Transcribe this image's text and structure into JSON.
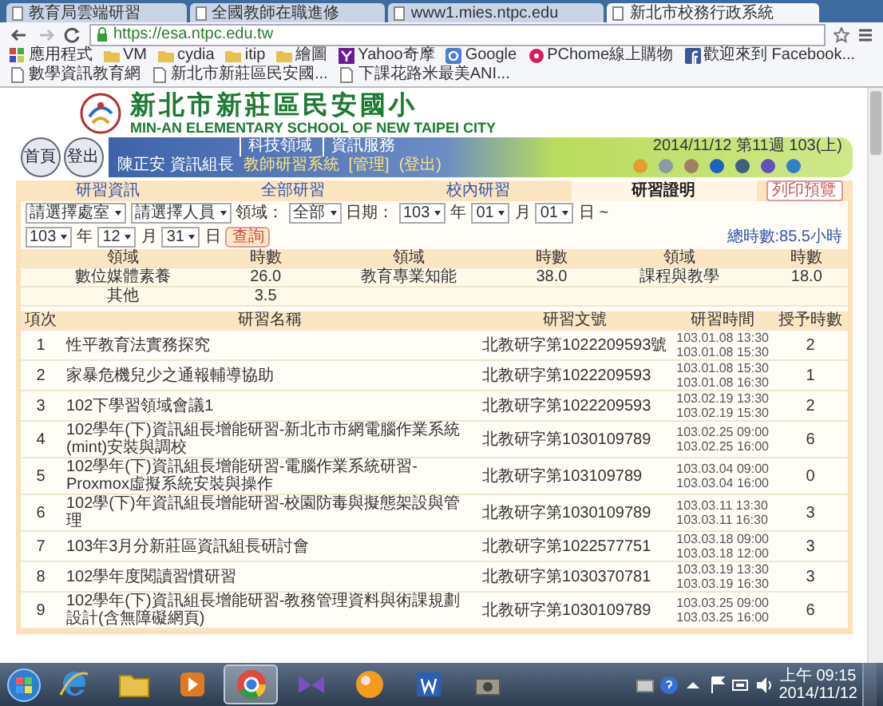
{
  "browser": {
    "tabs": [
      {
        "title": "教育局雲端研習",
        "selected": false
      },
      {
        "title": "全國教師在職進修",
        "selected": false
      },
      {
        "title": "www1.mies.ntpc.edu",
        "selected": false
      },
      {
        "title": "新北市校務行政系統",
        "selected": true
      }
    ],
    "address": "https://esa.ntpc.edu.tw",
    "bookmarks": [
      {
        "kind": "apps",
        "label": "應用程式"
      },
      {
        "kind": "folder",
        "label": "VM"
      },
      {
        "kind": "folder",
        "label": "cydia"
      },
      {
        "kind": "folder",
        "label": "itip"
      },
      {
        "kind": "folder",
        "label": "繪圖"
      },
      {
        "kind": "yahoo",
        "label": "Yahoo奇摩"
      },
      {
        "kind": "google",
        "label": "Google"
      },
      {
        "kind": "pchome",
        "label": "PChome線上購物"
      },
      {
        "kind": "facebook",
        "label": "歡迎來到 Facebook..."
      },
      {
        "kind": "page",
        "label": "數學資訊教育網"
      },
      {
        "kind": "page",
        "label": "新北市新莊區民安國..."
      },
      {
        "kind": "page",
        "label": "下課花路米最美ANI..."
      }
    ]
  },
  "school": {
    "name": "新北市新莊區民安國小",
    "english_name": "MIN-AN ELEMENTARY SCHOOL OF NEW TAIPEI CITY"
  },
  "nav": {
    "round_buttons": [
      "首頁",
      "登出"
    ],
    "links": [
      "科技領域",
      "資訊服務"
    ],
    "date": "2014/11/12 第11週 103(上)",
    "user": "陳正安 資訊組長",
    "system": "教師研習系統",
    "admin": "[管理]",
    "logout": "(登出)"
  },
  "page_tabs": [
    {
      "label": "研習資訊",
      "selected": false
    },
    {
      "label": "全部研習",
      "selected": false
    },
    {
      "label": "校內研習",
      "selected": false
    },
    {
      "label": "研習證明",
      "selected": true
    }
  ],
  "print_button": "列印預覽",
  "filter_rows": [
    [
      {
        "kind": "select",
        "value": "請選擇處室"
      },
      {
        "kind": "select",
        "value": "請選擇人員"
      },
      {
        "kind": "label",
        "text": "領域："
      },
      {
        "kind": "select",
        "value": "全部"
      },
      {
        "kind": "label",
        "text": "日期："
      },
      {
        "kind": "select",
        "value": "103"
      },
      {
        "kind": "label",
        "text": "年"
      },
      {
        "kind": "select",
        "value": "01"
      },
      {
        "kind": "label",
        "text": "月"
      },
      {
        "kind": "select",
        "value": "01"
      },
      {
        "kind": "label",
        "text": "日 ~"
      }
    ],
    [
      {
        "kind": "select",
        "value": "103"
      },
      {
        "kind": "label",
        "text": "年"
      },
      {
        "kind": "select",
        "value": "12"
      },
      {
        "kind": "label",
        "text": "月"
      },
      {
        "kind": "select",
        "value": "31"
      },
      {
        "kind": "label",
        "text": "日"
      },
      {
        "kind": "button",
        "text": "查詢"
      }
    ]
  ],
  "total_hours": "總時數:85.5小時",
  "summary": {
    "columns": [
      "領域",
      "時數",
      "領域",
      "時數",
      "領域",
      "時數"
    ],
    "rows": [
      [
        "數位媒體素養",
        "26.0",
        "教育專業知能",
        "38.0",
        "課程與教學",
        "18.0"
      ],
      [
        "其他",
        "3.5",
        "",
        "",
        "",
        ""
      ]
    ]
  },
  "table": {
    "columns": [
      "項次",
      "研習名稱",
      "研習文號",
      "研習時間",
      "授予時數"
    ],
    "rows": [
      {
        "no": "1",
        "name": "性平教育法實務探究",
        "doc": "北教研字第1022209593號",
        "start": "103.01.08 13:30",
        "end": "103.01.08 15:30",
        "hours": "2"
      },
      {
        "no": "2",
        "name": "家暴危機兒少之通報輔導協助",
        "doc": "北教研字第1022209593",
        "start": "103.01.08 15:30",
        "end": "103.01.08 16:30",
        "hours": "1"
      },
      {
        "no": "3",
        "name": "102下學習領域會議1",
        "doc": "北教研字第1022209593",
        "start": "103.02.19 13:30",
        "end": "103.02.19 15:30",
        "hours": "2"
      },
      {
        "no": "4",
        "name": "102學年(下)資訊組長增能研習-新北市市網電腦作業系統(mint)安裝與調校",
        "doc": "北教研字第1030109789",
        "start": "103.02.25 09:00",
        "end": "103.02.25 16:00",
        "hours": "6"
      },
      {
        "no": "5",
        "name": "102學年(下)資訊組長增能研習-電腦作業系統研習-Proxmox虛擬系統安裝與操作",
        "doc": "北教研字第103109789",
        "start": "103.03.04 09:00",
        "end": "103.03.04 16:00",
        "hours": "0"
      },
      {
        "no": "6",
        "name": "102學(下)年資訊組長增能研習-校園防毒與擬態架設與管理",
        "doc": "北教研字第1030109789",
        "start": "103.03.11 13:30",
        "end": "103.03.11 16:30",
        "hours": "3"
      },
      {
        "no": "7",
        "name": "103年3月分新莊區資訊組長研討會",
        "doc": "北教研字第1022577751",
        "start": "103.03.18 09:00",
        "end": "103.03.18 12:00",
        "hours": "3"
      },
      {
        "no": "8",
        "name": "102學年度閱讀習慣研習",
        "doc": "北教研字第1030370781",
        "start": "103.03.19 13:30",
        "end": "103.03.19 16:30",
        "hours": "3"
      },
      {
        "no": "9",
        "name": "102學年(下)資訊組長增能研習-教務管理資料與術課規劃設計(含無障礙網頁)",
        "doc": "北教研字第1030109789",
        "start": "103.03.25 09:00",
        "end": "103.03.25 16:00",
        "hours": "6"
      }
    ]
  },
  "taskbar": {
    "apps": [
      {
        "kind": "ie",
        "active": false
      },
      {
        "kind": "folder",
        "active": false
      },
      {
        "kind": "media",
        "active": false
      },
      {
        "kind": "chrome",
        "active": true
      },
      {
        "kind": "vs",
        "active": false
      },
      {
        "kind": "orange",
        "active": false
      },
      {
        "kind": "word",
        "active": false
      },
      {
        "kind": "camera",
        "active": false
      }
    ],
    "time": "上午 09:15",
    "date": "2014/11/12"
  }
}
